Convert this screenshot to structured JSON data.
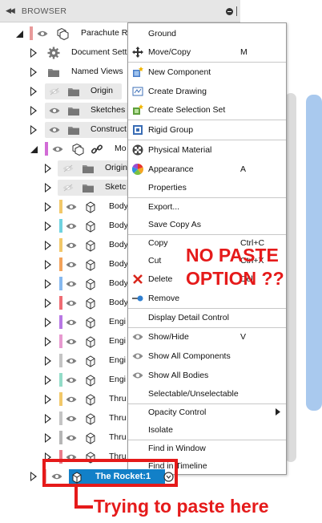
{
  "header": {
    "title": "BROWSER"
  },
  "tree": {
    "root_label": "Parachute R",
    "items": [
      {
        "label": "Document Setti"
      },
      {
        "label": "Named Views"
      },
      {
        "label": "Origin"
      },
      {
        "label": "Sketches"
      },
      {
        "label": "Construct"
      },
      {
        "label": "Mo"
      },
      {
        "label": "Origin"
      },
      {
        "label": "Sketc"
      },
      {
        "label": "Body"
      },
      {
        "label": "Body"
      },
      {
        "label": "Body"
      },
      {
        "label": "Body"
      },
      {
        "label": "Body"
      },
      {
        "label": "Body"
      },
      {
        "label": "Engi"
      },
      {
        "label": "Engi"
      },
      {
        "label": "Engi"
      },
      {
        "label": "Engi"
      },
      {
        "label": "Thru"
      },
      {
        "label": "Thru"
      },
      {
        "label": "Thru"
      },
      {
        "label": "Thru"
      }
    ],
    "selected_label": "The Rocket:1"
  },
  "menu": {
    "ground": "Ground",
    "move_copy": "Move/Copy",
    "move_copy_sc": "M",
    "new_component": "New Component",
    "create_drawing": "Create Drawing",
    "create_selection_set": "Create Selection Set",
    "rigid_group": "Rigid Group",
    "physical_material": "Physical Material",
    "appearance": "Appearance",
    "appearance_sc": "A",
    "properties": "Properties",
    "export": "Export...",
    "save_copy_as": "Save Copy As",
    "copy": "Copy",
    "copy_sc": "Ctrl+C",
    "cut": "Cut",
    "cut_sc": "Ctrl+X",
    "delete": "Delete",
    "delete_sc": "Del",
    "remove": "Remove",
    "display_detail_control": "Display Detail Control",
    "show_hide": "Show/Hide",
    "show_hide_sc": "V",
    "show_all_components": "Show All Components",
    "show_all_bodies": "Show All Bodies",
    "selectable_unselectable": "Selectable/Unselectable",
    "opacity_control": "Opacity Control",
    "isolate": "Isolate",
    "find_in_window": "Find in Window",
    "find_in_timeline": "Find in Timeline"
  },
  "annotations": {
    "no_paste_line1": "NO PASTE",
    "no_paste_line2": "OPTION ??",
    "trying": "Trying to paste here"
  },
  "colors": {
    "annotation": "#e51a1a",
    "selection": "#1280c8",
    "scrollbar": "#a9c9ee"
  }
}
